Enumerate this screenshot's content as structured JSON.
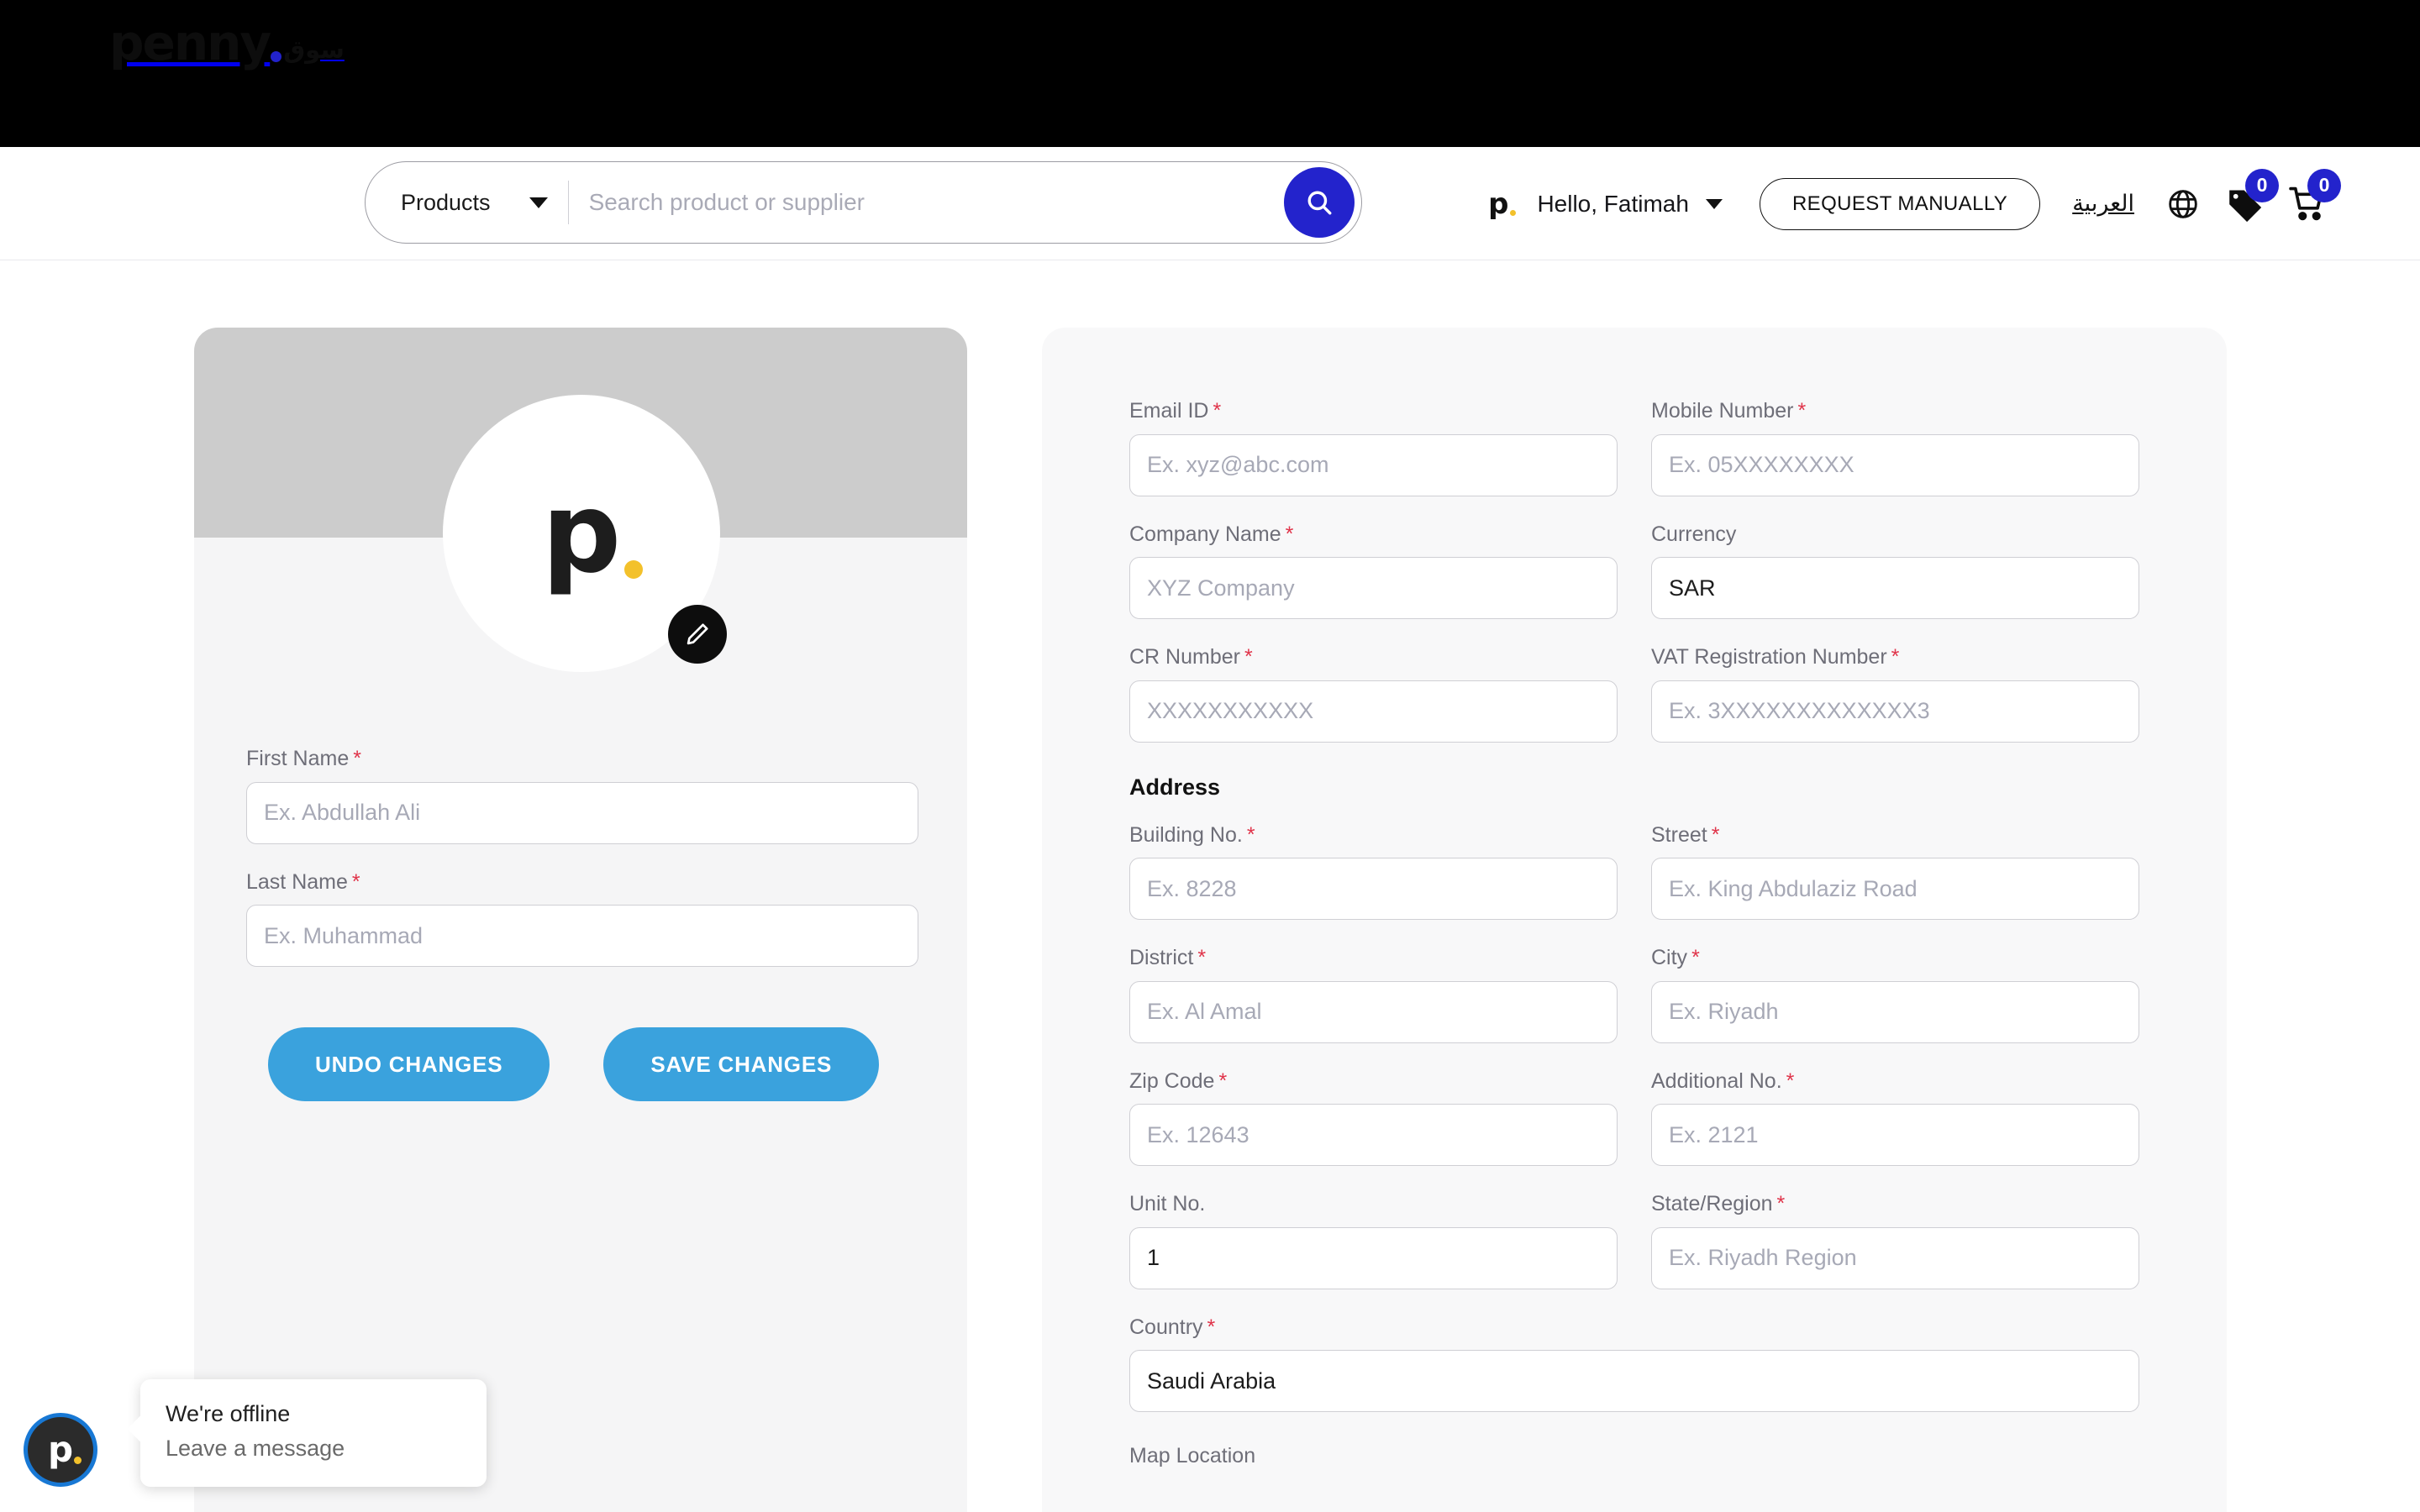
{
  "brand": {
    "logo_word": "penny",
    "logo_arabic": "سوق",
    "mini_logo": "p",
    "avatar_mark": "p",
    "accent_blue": "#2323cc",
    "accent_yellow": "#f3c12b",
    "button_blue": "#3aa2dd",
    "required_red": "#e0344a"
  },
  "header": {
    "search": {
      "category_label": "Products",
      "placeholder": "Search product or supplier",
      "value": "",
      "chevron_icon": "chevron-down-icon",
      "search_icon": "search-icon"
    },
    "greeting": "Hello, Fatimah",
    "account_caret_icon": "chevron-down-icon",
    "request_manually_label": "REQUEST MANUALLY",
    "language_label": "العربية",
    "globe_icon": "globe-icon",
    "tag_icon": "tag-icon",
    "tag_badge": "0",
    "cart_icon": "cart-icon",
    "cart_badge": "0"
  },
  "profile_card": {
    "edit_avatar_icon": "pencil-icon",
    "fields": [
      {
        "label": "First Name",
        "required": true,
        "placeholder": "Ex. Abdullah Ali",
        "value": ""
      },
      {
        "label": "Last Name",
        "required": true,
        "placeholder": "Ex. Muhammad",
        "value": ""
      }
    ],
    "undo_label": "UNDO CHANGES",
    "save_label": "SAVE CHANGES"
  },
  "details_card": {
    "rows": [
      [
        {
          "label": "Email ID",
          "required": true,
          "placeholder": "Ex. xyz@abc.com",
          "value": ""
        },
        {
          "label": "Mobile Number",
          "required": true,
          "placeholder": "Ex. 05XXXXXXXX",
          "value": ""
        }
      ],
      [
        {
          "label": "Company Name",
          "required": true,
          "placeholder": "XYZ Company",
          "value": ""
        },
        {
          "label": "Currency",
          "required": false,
          "placeholder": "",
          "value": "SAR"
        }
      ],
      [
        {
          "label": "CR Number",
          "required": true,
          "placeholder": "XXXXXXXXXXX",
          "value": ""
        },
        {
          "label": "VAT Registration Number",
          "required": true,
          "placeholder": "Ex. 3XXXXXXXXXXXXX3",
          "value": ""
        }
      ]
    ],
    "address_title": "Address",
    "address_rows": [
      [
        {
          "label": "Building No.",
          "required": true,
          "placeholder": "Ex. 8228",
          "value": ""
        },
        {
          "label": "Street",
          "required": true,
          "placeholder": "Ex. King Abdulaziz Road",
          "value": ""
        }
      ],
      [
        {
          "label": "District",
          "required": true,
          "placeholder": "Ex. Al Amal",
          "value": ""
        },
        {
          "label": "City",
          "required": true,
          "placeholder": "Ex. Riyadh",
          "value": ""
        }
      ],
      [
        {
          "label": "Zip Code",
          "required": true,
          "placeholder": "Ex. 12643",
          "value": ""
        },
        {
          "label": "Additional No.",
          "required": true,
          "placeholder": "Ex. 2121",
          "value": ""
        }
      ],
      [
        {
          "label": "Unit No.",
          "required": false,
          "placeholder": "",
          "value": "1"
        },
        {
          "label": "State/Region",
          "required": true,
          "placeholder": "Ex. Riyadh Region",
          "value": ""
        }
      ]
    ],
    "country": {
      "label": "Country",
      "required": true,
      "placeholder": "",
      "value": "Saudi Arabia"
    },
    "map_location_label": "Map Location"
  },
  "chat": {
    "avatar_mark": "p",
    "title": "We're offline",
    "subtitle": "Leave a message"
  }
}
